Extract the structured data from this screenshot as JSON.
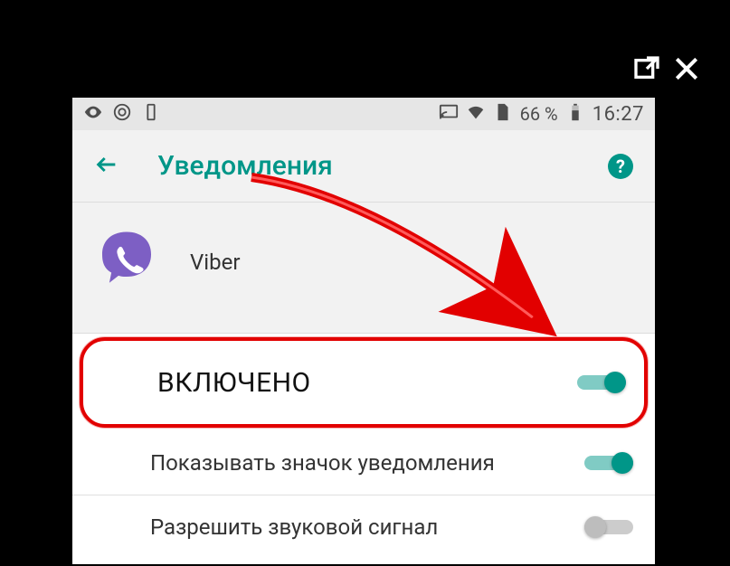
{
  "outer": {
    "open_label": "open-external",
    "close_label": "close"
  },
  "status": {
    "battery_text": "66 %",
    "time": "16:27"
  },
  "appbar": {
    "title": "Уведомления",
    "help_glyph": "?"
  },
  "app_info": {
    "name": "Viber"
  },
  "settings": {
    "main": {
      "label": "ВКЛЮЧЕНО",
      "on": true
    },
    "badge": {
      "label": "Показывать значок уведомления",
      "on": true
    },
    "sound": {
      "label": "Разрешить звуковой сигнал",
      "on": false
    }
  }
}
